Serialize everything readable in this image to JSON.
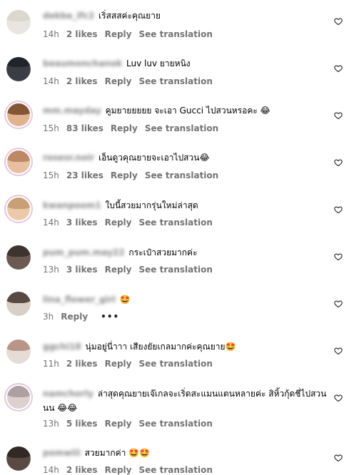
{
  "comments": [
    {
      "user": "dekba_ifc2",
      "text": "เริ่สสสค่ะคุณยาย",
      "time": "14h",
      "likes": "2 likes",
      "reply": "Reply",
      "translate": "See translation"
    },
    {
      "user": "beaumonchanok",
      "text": "Luv luv ยายหนิง",
      "time": "14h",
      "likes": "2 likes",
      "reply": "Reply",
      "translate": "See translation"
    },
    {
      "user": "mm.mayday",
      "text": "คูมยายยยยย จะเอา Gucci ไปสวนหรอคะ 😂",
      "time": "15h",
      "likes": "83 likes",
      "reply": "Reply",
      "translate": "See translation"
    },
    {
      "user": "rosesr.noir",
      "text": "เอ็นดูวคุณยายจะเอาไปสวน😂",
      "time": "15h",
      "likes": "23 likes",
      "reply": "Reply",
      "translate": "See translation"
    },
    {
      "user": "kwanpoom1",
      "text": "ใบนี้สวยมากรุ่นใหม่ล่าสุด",
      "time": "14h",
      "likes": "3 likes",
      "reply": "Reply",
      "translate": "See translation"
    },
    {
      "user": "pum_pum.may22",
      "text": "กระเป๋าสวยมากค่ะ",
      "time": "13h",
      "likes": "3 likes",
      "reply": "Reply",
      "translate": "See translation"
    },
    {
      "user": "lina_flower_girl",
      "text": "🤩",
      "time": "3h",
      "reply": "Reply",
      "more": "•••"
    },
    {
      "user": "ggchi18",
      "text": "นุ่มอยู่นี่าาา เสียงยัยเกลมากค่ะคุณยาย🤩",
      "time": "11h",
      "likes": "2 likes",
      "reply": "Reply",
      "translate": "See translation"
    },
    {
      "user": "namchorly",
      "text": "ล่าสุดคุณยายเจ๊เกลจะเริ่ดสะแมนแตนหลายค่ะ สิหิ้วกุ้ดชี่ไปสวนนน 😂😂",
      "time": "13h",
      "likes": "5 likes",
      "reply": "Reply",
      "translate": "See translation"
    },
    {
      "user": "pomwiii",
      "text": "สวยมากค่า 🤩🤩",
      "time": "14h",
      "likes": "2 likes",
      "reply": "Reply",
      "translate": "See translation"
    }
  ],
  "colors": {
    "meta": "#737373",
    "username": "#8a8a8a",
    "heart": "#262626"
  }
}
